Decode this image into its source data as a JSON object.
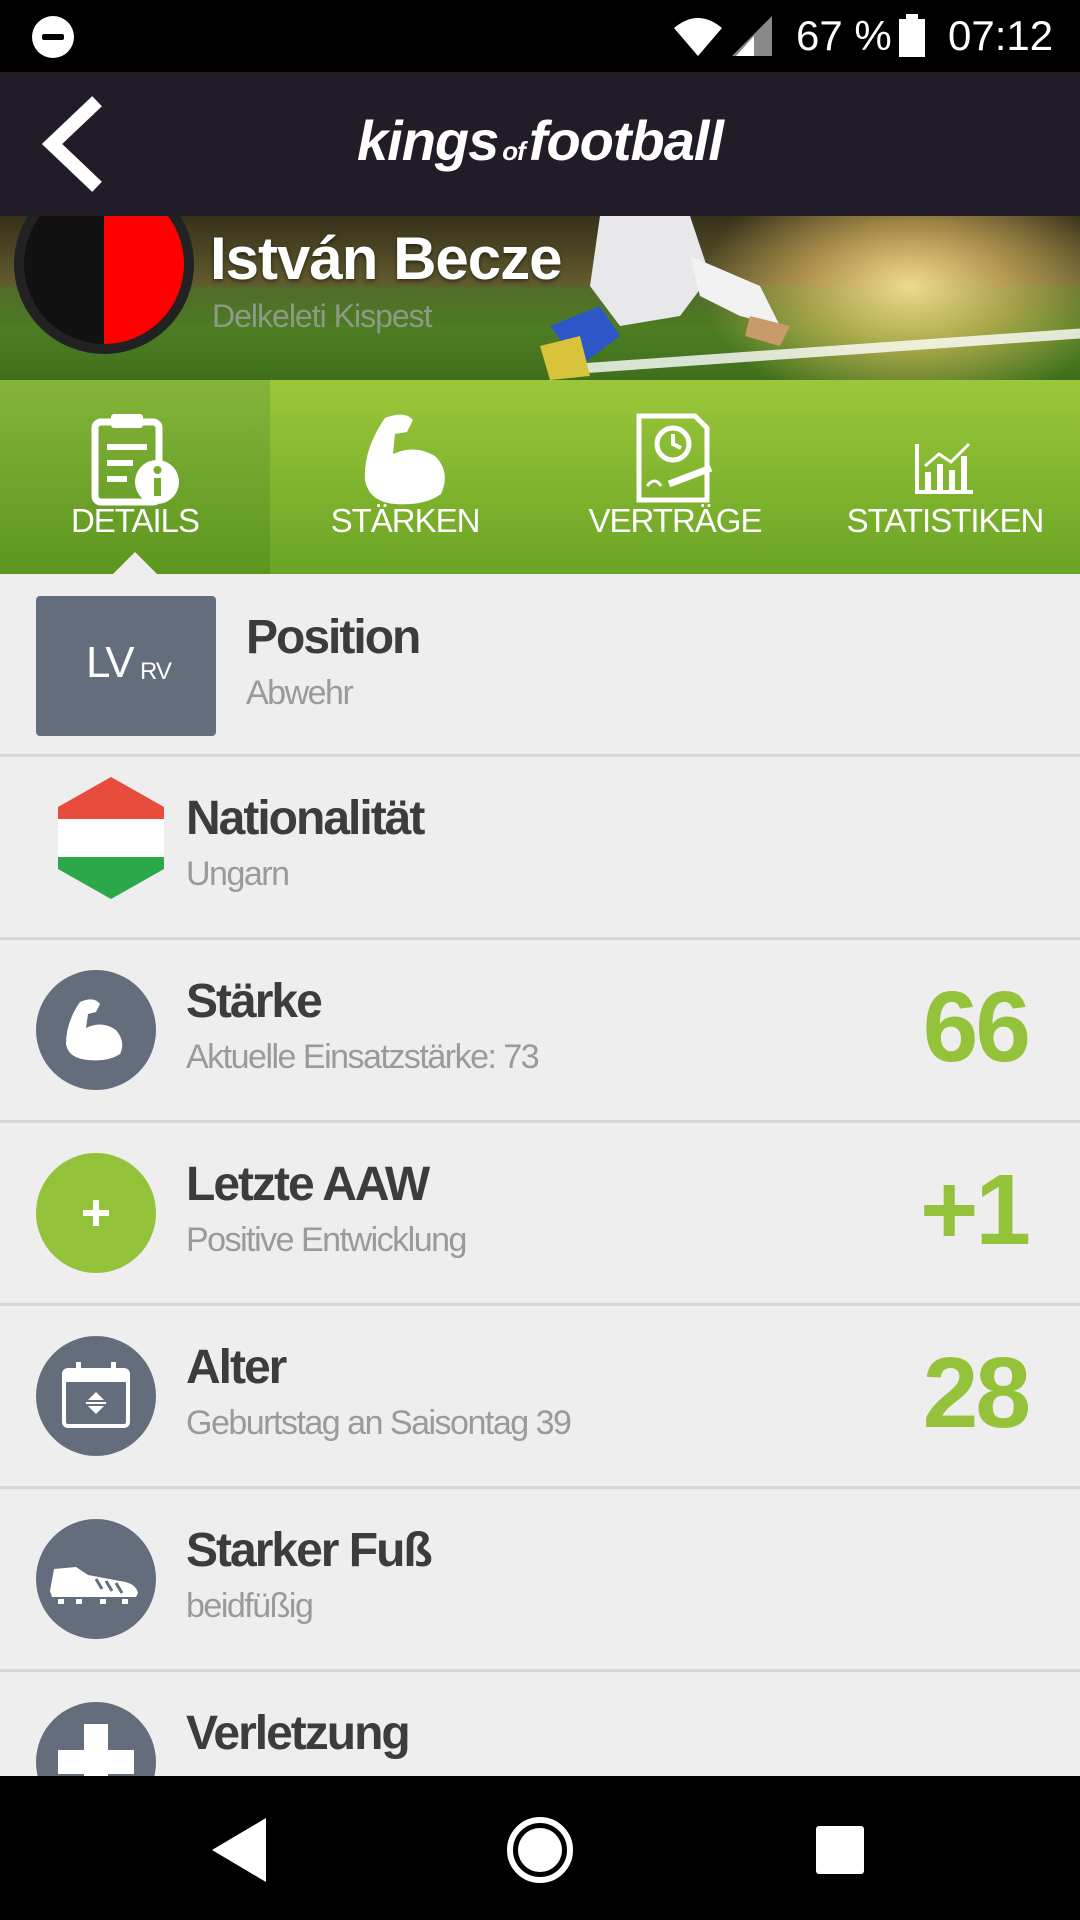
{
  "status_bar": {
    "battery_percent": "67 %",
    "time": "07:12"
  },
  "app_bar": {
    "logo_part1": "kings",
    "logo_part2": "of",
    "logo_part3": "football"
  },
  "player": {
    "name": "István Becze",
    "club": "Delkeleti Kispest"
  },
  "tabs": [
    {
      "label": "DETAILS",
      "icon": "clipboard-info-icon",
      "active": true
    },
    {
      "label": "STÄRKEN",
      "icon": "biceps-icon",
      "active": false
    },
    {
      "label": "VERTRÄGE",
      "icon": "contract-clock-icon",
      "active": false
    },
    {
      "label": "STATISTIKEN",
      "icon": "bar-chart-icon",
      "active": false
    }
  ],
  "details": {
    "position": {
      "title": "Position",
      "subtitle": "Abwehr",
      "main": "LV",
      "secondary": "RV"
    },
    "nationality": {
      "title": "Nationalität",
      "subtitle": "Ungarn"
    },
    "strength": {
      "title": "Stärke",
      "subtitle": "Aktuelle Einsatzstärke: 73",
      "value": "66"
    },
    "last_aaw": {
      "title": "Letzte AAW",
      "subtitle": "Positive Entwicklung",
      "value": "+1"
    },
    "age": {
      "title": "Alter",
      "subtitle": "Geburtstag an Saisontag 39",
      "value": "28"
    },
    "strong_foot": {
      "title": "Starker Fuß",
      "subtitle": "beidfüßig"
    },
    "injury": {
      "title": "Verletzung"
    }
  },
  "colors": {
    "accent_green": "#94c23a",
    "appbar": "#221c29",
    "icon_grey": "#646d7c",
    "background": "#eeeeee",
    "flag_red": "#e84c3d",
    "flag_green": "#2aa84a"
  }
}
